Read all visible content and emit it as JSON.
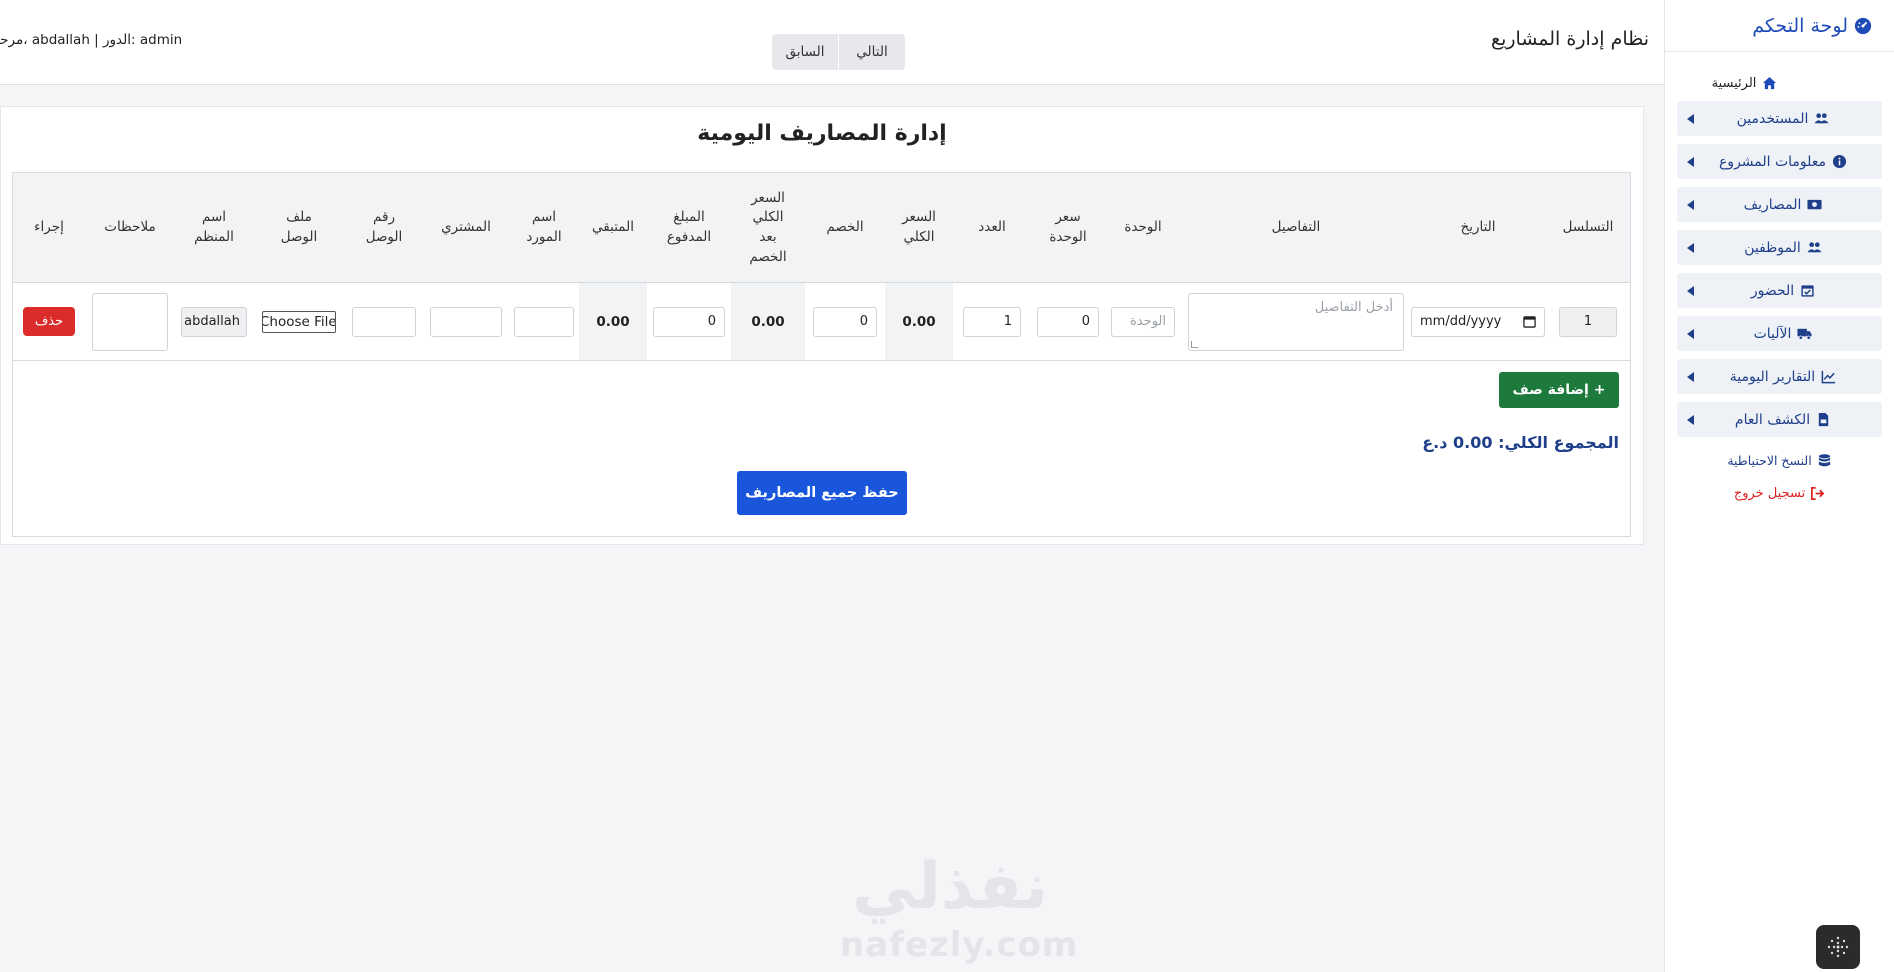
{
  "sidebar": {
    "title": "لوحة التحكم",
    "home": "الرئيسية",
    "items": [
      {
        "label": "المستخدمين",
        "icon": "users-icon"
      },
      {
        "label": "معلومات المشروع",
        "icon": "info-icon"
      },
      {
        "label": "المصاريف",
        "icon": "money-icon"
      },
      {
        "label": "الموظفين",
        "icon": "users-icon"
      },
      {
        "label": "الحضور",
        "icon": "calendar-check-icon"
      },
      {
        "label": "الآليات",
        "icon": "truck-icon"
      },
      {
        "label": "التقارير اليومية",
        "icon": "chart-line-icon"
      },
      {
        "label": "الكشف العام",
        "icon": "file-invoice-icon"
      }
    ],
    "backup": "النسخ الاحتياطية",
    "logout": "تسجيل خروج"
  },
  "topbar": {
    "app_title": "نظام إدارة المشاريع",
    "next": "التالي",
    "prev": "السابق",
    "user_info": "مرحباً، abdallah | الدور: admin"
  },
  "main": {
    "title": "إدارة المصاريف اليومية",
    "headers": [
      "التسلسل",
      "التاريخ",
      "التفاصيل",
      "الوحدة",
      "سعر الوحدة",
      "العدد",
      "السعر الكلي",
      "الخصم",
      "السعر الكلي بعد الخصم",
      "المبلغ المدفوع",
      "المتبقي",
      "اسم المورد",
      "المشتري",
      "رقم الوصل",
      "ملف الوصل",
      "اسم المنظم",
      "ملاحظات",
      "إجراء"
    ],
    "row": {
      "serial": "1",
      "date_placeholder": "mm/dd/yyyy",
      "details_placeholder": "أدخل التفاصيل",
      "unit_placeholder": "الوحدة",
      "unit_price": "0",
      "count": "1",
      "total_price": "0.00",
      "discount": "0",
      "total_after_discount": "0.00",
      "paid": "0",
      "remaining": "0.00",
      "supplier": "",
      "buyer": "",
      "receipt_no": "",
      "file_button": "Choose File",
      "organizer": "abdallah",
      "notes": "",
      "delete": "حذف"
    },
    "add_row": "+ إضافة صف",
    "total_label": "المجموع الكلي:",
    "total_value": "0.00 د.ع",
    "save_all": "حفظ جميع المصاريف"
  },
  "watermark": {
    "arabic": "نفذلي",
    "latin": "nafezly.com"
  },
  "colors": {
    "accent": "#1f4bb8",
    "save": "#1a56db",
    "add": "#1d7a3c",
    "delete": "#dc2b2b"
  }
}
